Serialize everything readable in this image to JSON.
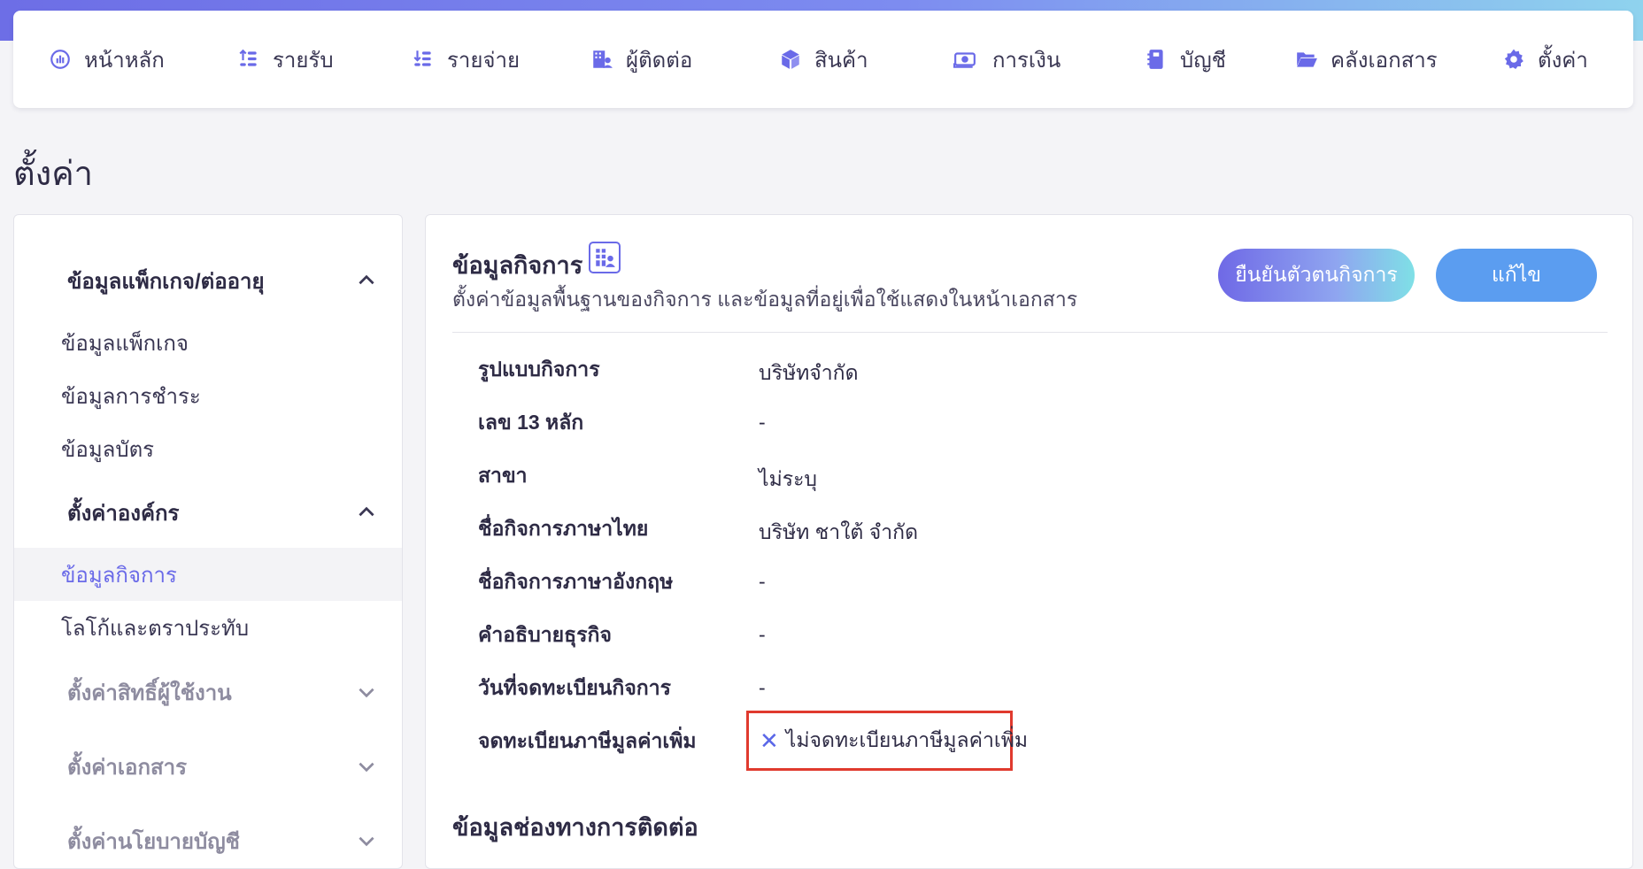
{
  "nav": {
    "items": [
      {
        "label": "หน้าหลัก",
        "icon": "dashboard-gauge-icon"
      },
      {
        "label": "รายรับ",
        "icon": "income-icon"
      },
      {
        "label": "รายจ่าย",
        "icon": "expense-icon"
      },
      {
        "label": "ผู้ติดต่อ",
        "icon": "contacts-icon"
      },
      {
        "label": "สินค้า",
        "icon": "box-icon"
      },
      {
        "label": "การเงิน",
        "icon": "money-icon"
      },
      {
        "label": "บัญชี",
        "icon": "ledger-icon"
      },
      {
        "label": "คลังเอกสาร",
        "icon": "folder-icon"
      },
      {
        "label": "ตั้งค่า",
        "icon": "gear-icon"
      }
    ]
  },
  "page": {
    "title": "ตั้งค่า"
  },
  "sidebar": {
    "group_package": "ข้อมูลแพ็กเกจ/ต่ออายุ",
    "item_package": "ข้อมูลแพ็กเกจ",
    "item_payment": "ข้อมูลการชำระ",
    "item_card": "ข้อมูลบัตร",
    "group_org": "ตั้งค่าองค์กร",
    "item_business": "ข้อมูลกิจการ",
    "item_logo": "โลโก้และตราประทับ",
    "group_permissions": "ตั้งค่าสิทธิ์ผู้ใช้งาน",
    "group_documents": "ตั้งค่าเอกสาร",
    "group_policy": "ตั้งค่านโยบายบัญชี"
  },
  "panel": {
    "title": "ข้อมูลกิจการ",
    "subtitle": "ตั้งค่าข้อมูลพื้นฐานของกิจการ และข้อมูลที่อยู่เพื่อใช้แสดงในหน้าเอกสาร",
    "verify_label": "ยืนยันตัวตนกิจการ",
    "edit_label": "แก้ไข",
    "fields": [
      {
        "label": "รูปแบบกิจการ",
        "value": "บริษัทจำกัด"
      },
      {
        "label": "เลข 13 หลัก",
        "value": "-"
      },
      {
        "label": "สาขา",
        "value": "ไม่ระบุ"
      },
      {
        "label": "ชื่อกิจการภาษาไทย",
        "value": "บริษัท ชาใต้ จำกัด"
      },
      {
        "label": "ชื่อกิจการภาษาอังกฤษ",
        "value": "-"
      },
      {
        "label": "คำอธิบายธุรกิจ",
        "value": "-"
      },
      {
        "label": "วันที่จดทะเบียนกิจการ",
        "value": "-"
      },
      {
        "label": "จดทะเบียนภาษีมูลค่าเพิ่ม",
        "value": "ไม่จดทะเบียนภาษีมูลค่าเพิ่ม"
      }
    ],
    "vat_mark": "✕",
    "section2_title": "ข้อมูลช่องทางการติดต่อ"
  },
  "colors": {
    "accent": "#6a6ae8",
    "edit_button": "#5b9df0",
    "highlight_border": "#e03a2e"
  }
}
